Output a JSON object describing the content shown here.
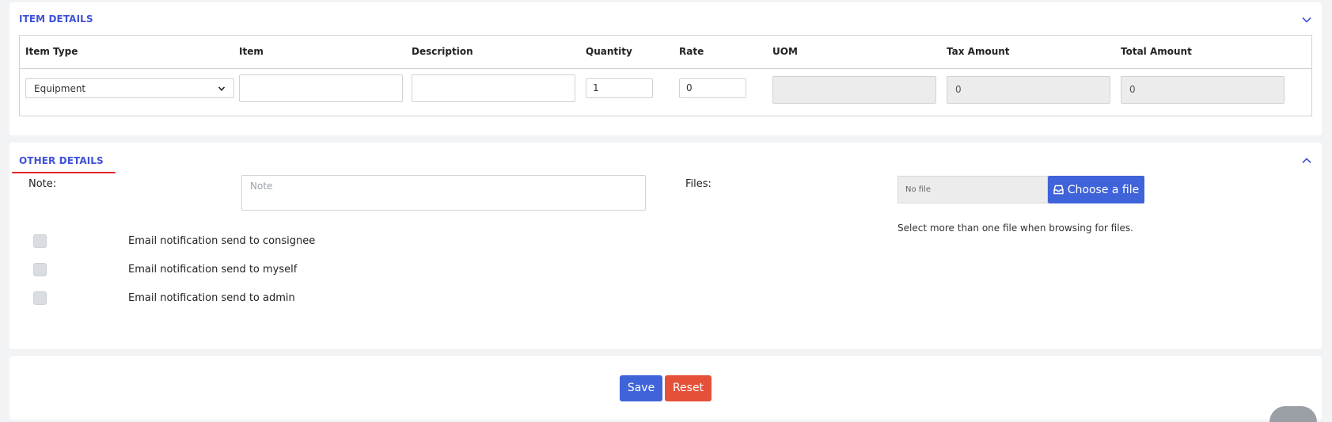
{
  "item_details": {
    "title": "ITEM DETAILS",
    "columns": [
      "Item Type",
      "Item",
      "Description",
      "Quantity",
      "Rate",
      "UOM",
      "Tax Amount",
      "Total Amount"
    ],
    "row": {
      "item_type": "Equipment",
      "item": "",
      "description": "",
      "quantity": "1",
      "rate": "0",
      "uom": "",
      "tax_amount": "0",
      "total_amount": "0"
    }
  },
  "other_details": {
    "title": "OTHER DETAILS",
    "note_label": "Note:",
    "note_placeholder": "Note",
    "files_label": "Files:",
    "file_placeholder": "No file",
    "choose_file_label": "Choose a file",
    "files_hint": "Select more than one file when browsing for files.",
    "checkboxes": [
      {
        "label": "Email notification send to consignee",
        "checked": false
      },
      {
        "label": "Email notification send to myself",
        "checked": false
      },
      {
        "label": "Email notification send to admin",
        "checked": false
      }
    ]
  },
  "actions": {
    "save_label": "Save",
    "reset_label": "Reset"
  },
  "colors": {
    "accent": "#3f51d8",
    "primary_button": "#3f63d8",
    "danger_button": "#e55039",
    "underline": "#e02424"
  },
  "icons": {
    "item_details_toggle": "chevron-down-icon",
    "other_details_toggle": "chevron-up-icon",
    "choose_file": "inbox-icon",
    "select_caret": "chevron-down-icon"
  }
}
